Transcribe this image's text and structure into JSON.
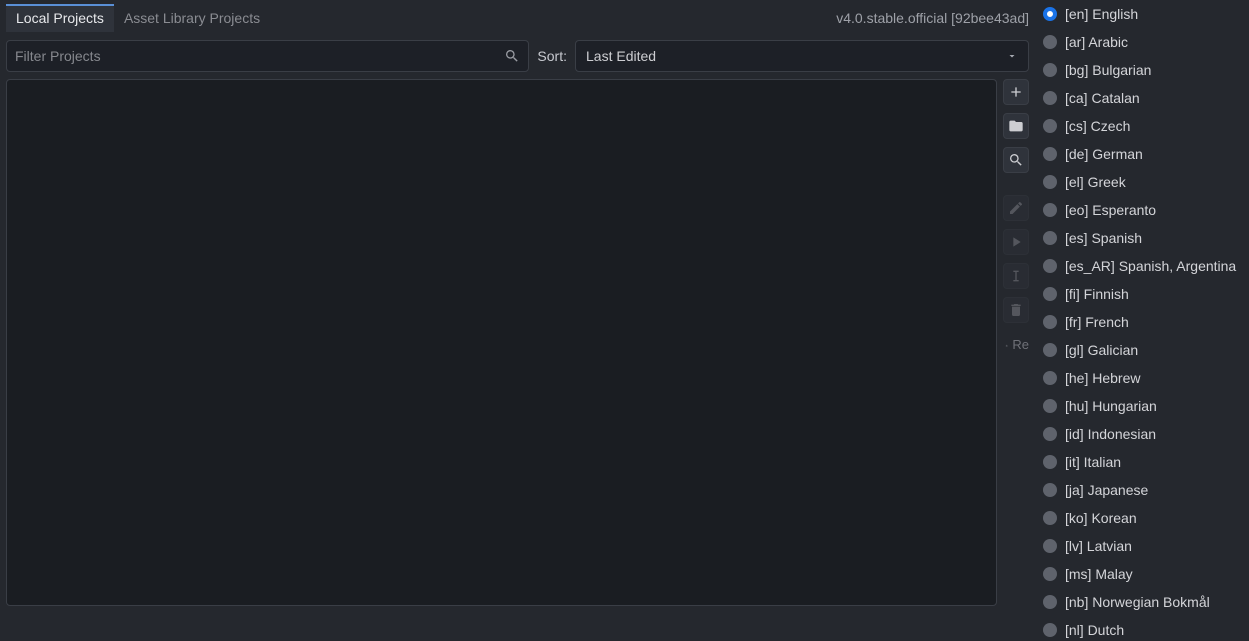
{
  "tabs": {
    "local": "Local Projects",
    "asset": "Asset Library Projects"
  },
  "version": "v4.0.stable.official [92bee43ad]",
  "filter": {
    "placeholder": "Filter Projects"
  },
  "sort": {
    "label": "Sort:",
    "selected": "Last Edited"
  },
  "side": {
    "remove_missing": "Re"
  },
  "languages": [
    {
      "code": "[en]",
      "name": "English",
      "selected": true
    },
    {
      "code": "[ar]",
      "name": "Arabic"
    },
    {
      "code": "[bg]",
      "name": "Bulgarian"
    },
    {
      "code": "[ca]",
      "name": "Catalan"
    },
    {
      "code": "[cs]",
      "name": "Czech"
    },
    {
      "code": "[de]",
      "name": "German"
    },
    {
      "code": "[el]",
      "name": "Greek"
    },
    {
      "code": "[eo]",
      "name": "Esperanto"
    },
    {
      "code": "[es]",
      "name": "Spanish"
    },
    {
      "code": "[es_AR]",
      "name": "Spanish, Argentina"
    },
    {
      "code": "[fi]",
      "name": "Finnish"
    },
    {
      "code": "[fr]",
      "name": "French"
    },
    {
      "code": "[gl]",
      "name": "Galician"
    },
    {
      "code": "[he]",
      "name": "Hebrew"
    },
    {
      "code": "[hu]",
      "name": "Hungarian"
    },
    {
      "code": "[id]",
      "name": "Indonesian"
    },
    {
      "code": "[it]",
      "name": "Italian"
    },
    {
      "code": "[ja]",
      "name": "Japanese"
    },
    {
      "code": "[ko]",
      "name": "Korean"
    },
    {
      "code": "[lv]",
      "name": "Latvian"
    },
    {
      "code": "[ms]",
      "name": "Malay"
    },
    {
      "code": "[nb]",
      "name": "Norwegian Bokmål"
    },
    {
      "code": "[nl]",
      "name": "Dutch"
    }
  ]
}
